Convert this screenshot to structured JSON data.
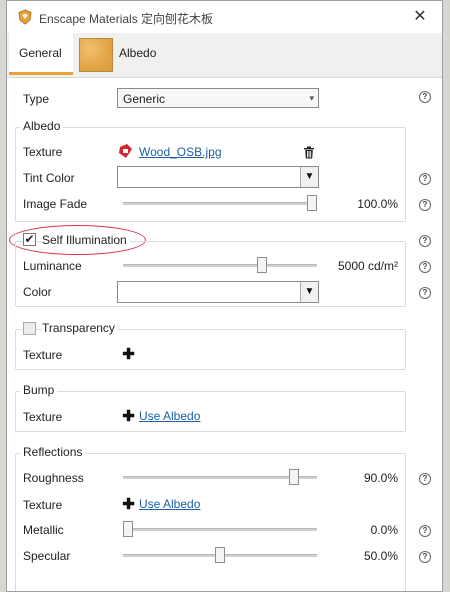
{
  "window": {
    "title": "Enscape Materials 定向刨花木板",
    "close_label": "✕"
  },
  "tabs": [
    {
      "label": "General",
      "active": true
    },
    {
      "label": "Albedo",
      "active": false
    }
  ],
  "type": {
    "label": "Type",
    "value": "Generic"
  },
  "albedo": {
    "title": "Albedo",
    "texture_label": "Texture",
    "texture_file": "Wood_OSB.jpg",
    "tint_label": "Tint Color",
    "fade_label": "Image Fade",
    "fade_value": "100.0%",
    "fade_fraction": 1.0
  },
  "self_illumination": {
    "label": "Self Illumination",
    "checked": true,
    "luminance_label": "Luminance",
    "luminance_value": "5000 cd/m²",
    "luminance_fraction": 0.73,
    "color_label": "Color"
  },
  "transparency": {
    "label": "Transparency",
    "checked": false,
    "texture_label": "Texture"
  },
  "bump": {
    "title": "Bump",
    "texture_label": "Texture",
    "link": "Use Albedo"
  },
  "reflections": {
    "title": "Reflections",
    "roughness_label": "Roughness",
    "roughness_value": "90.0%",
    "roughness_fraction": 0.9,
    "texture_label": "Texture",
    "texture_link": "Use Albedo",
    "metallic_label": "Metallic",
    "metallic_value": "0.0%",
    "metallic_fraction": 0.0,
    "specular_label": "Specular",
    "specular_value": "50.0%",
    "specular_fraction": 0.5
  },
  "help_glyph": "?",
  "colors": {
    "accent": "#e8a23a",
    "link": "#1f5fa6",
    "highlight": "#d9334a"
  }
}
